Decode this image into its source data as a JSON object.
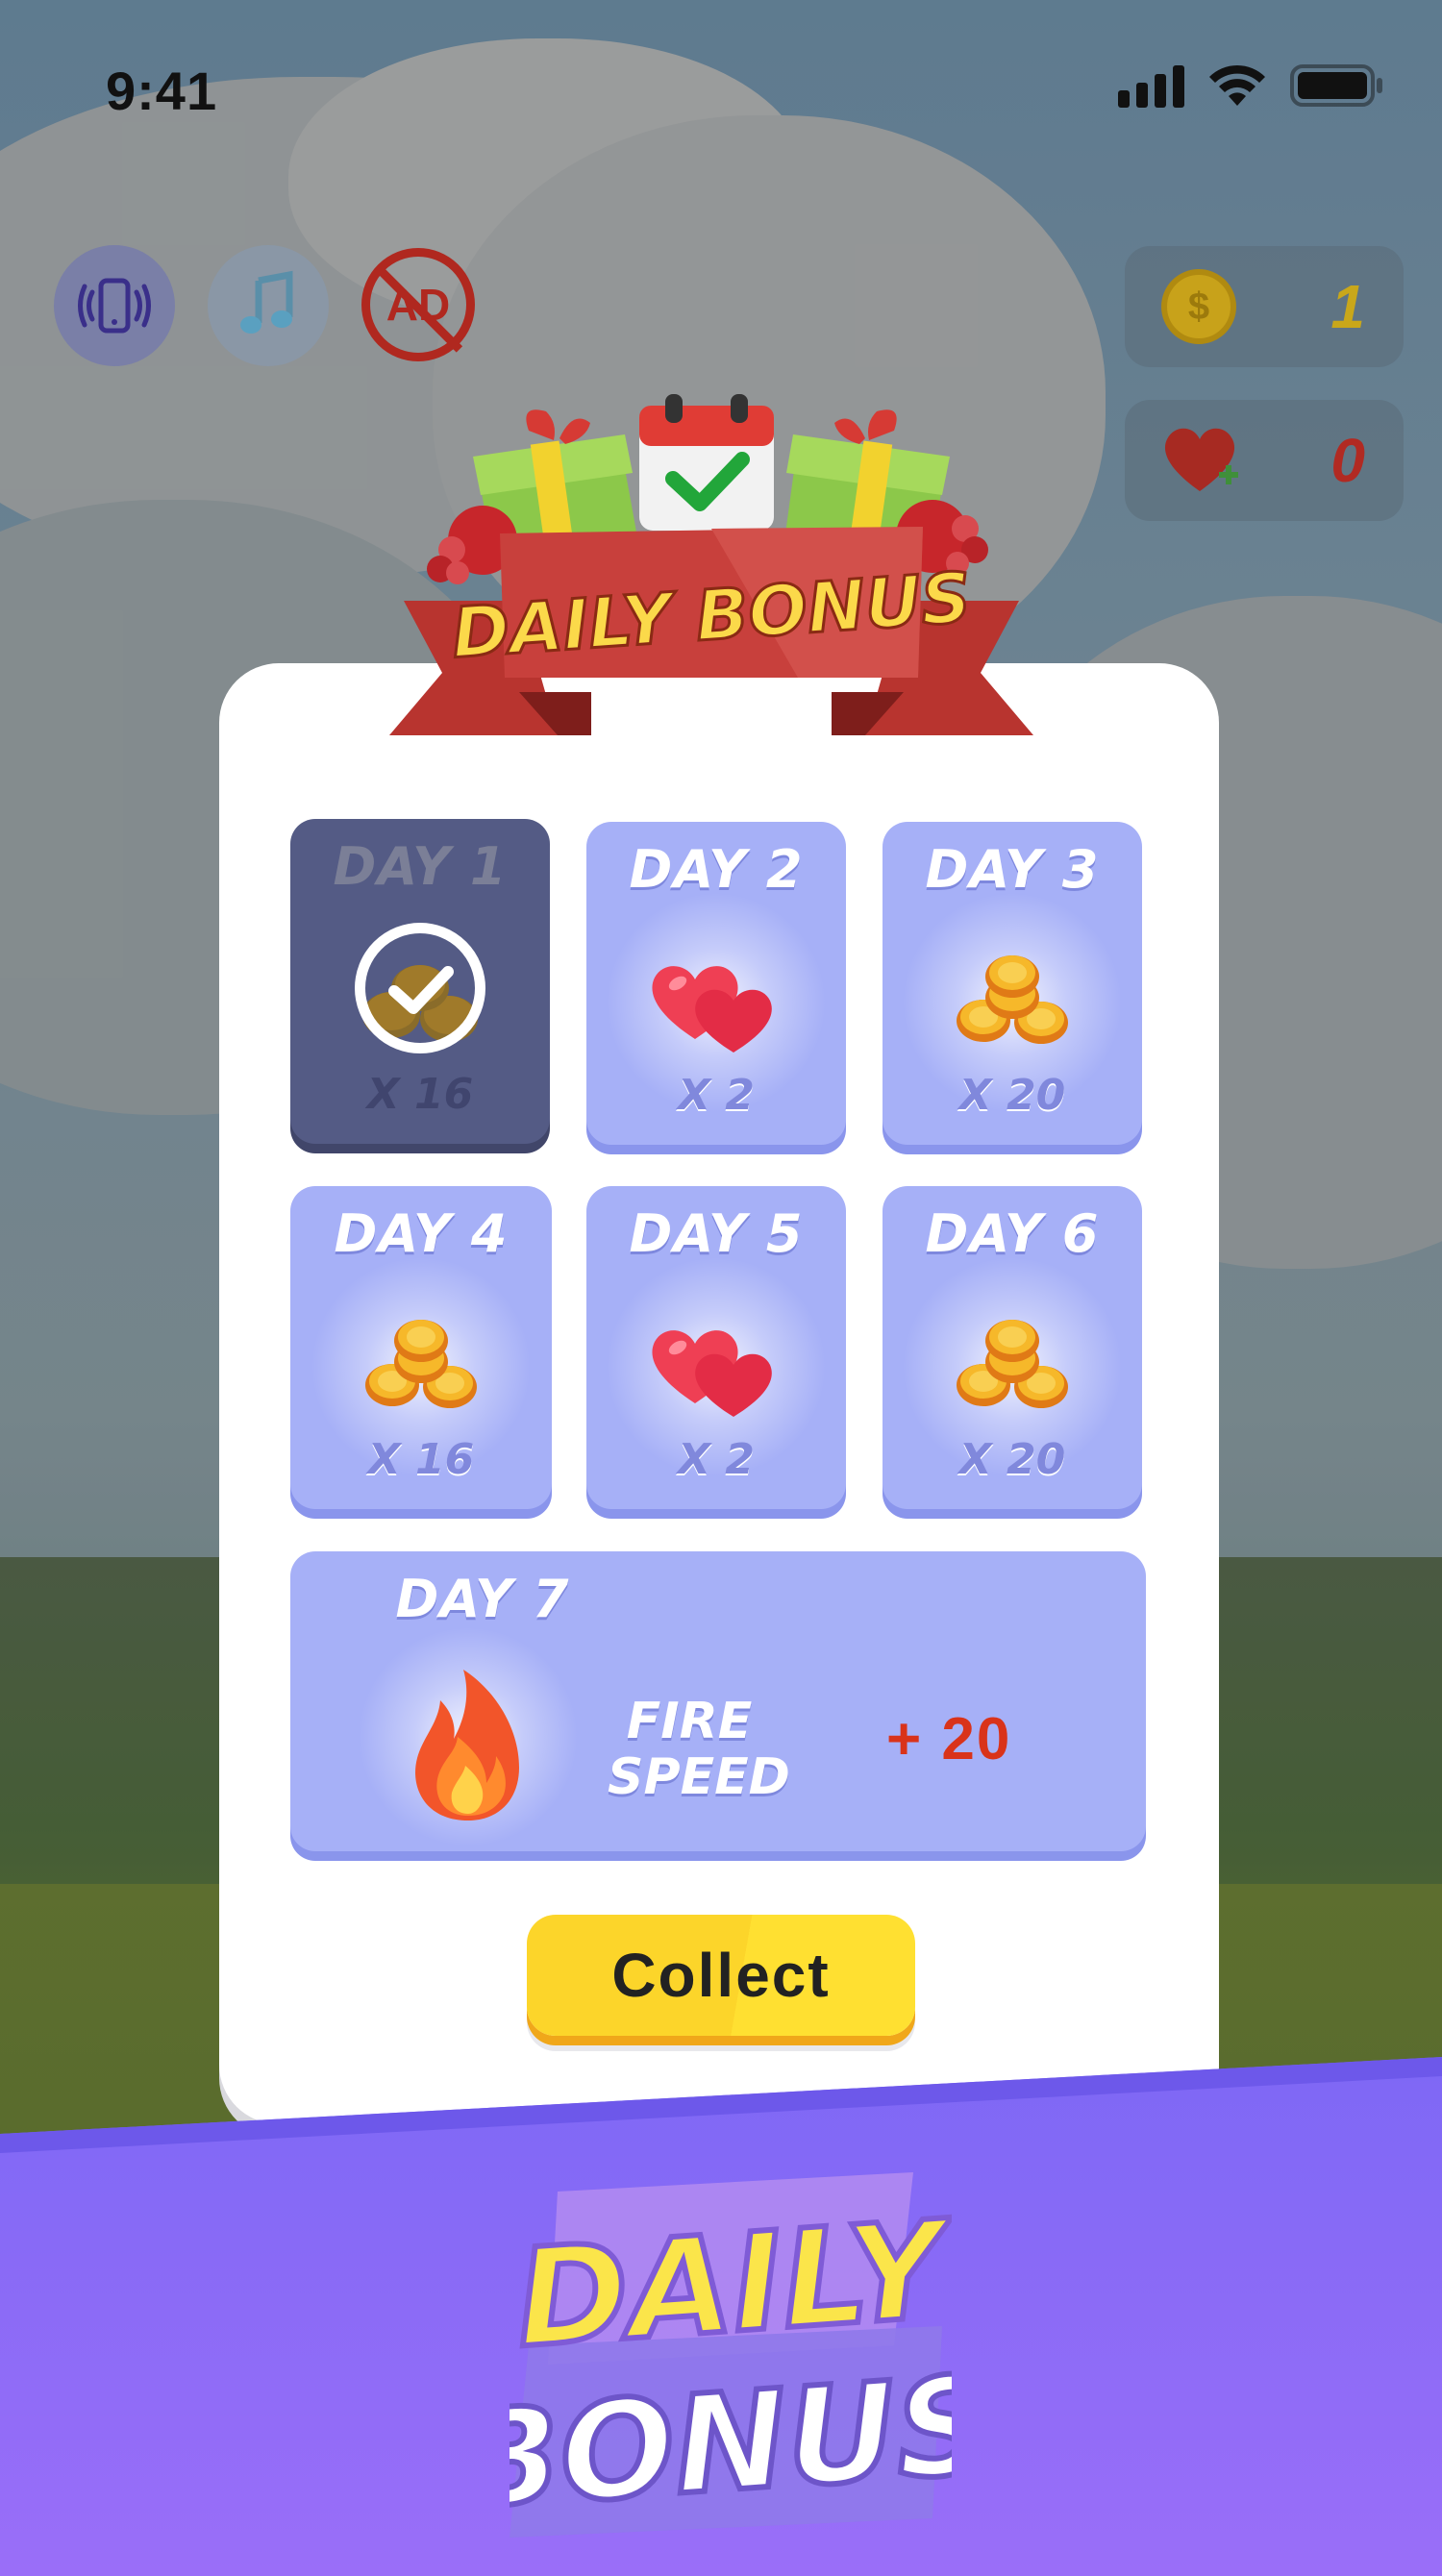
{
  "status_bar": {
    "time": "9:41"
  },
  "hud": {
    "vibration_icon": "vibration-icon",
    "music_icon": "music-note-icon",
    "no_ads_label": "AD",
    "coins": "1",
    "hearts": "0",
    "coin_color": "#c8a21a",
    "heart_color": "#b12a22"
  },
  "dialog": {
    "banner_title": "DAILY BONUS",
    "days": [
      {
        "label": "DAY 1",
        "reward": "coins",
        "qty": "X 16",
        "claimed": true
      },
      {
        "label": "DAY 2",
        "reward": "hearts",
        "qty": "X 2",
        "claimed": false
      },
      {
        "label": "DAY 3",
        "reward": "coins",
        "qty": "X 20",
        "claimed": false
      },
      {
        "label": "DAY 4",
        "reward": "coins",
        "qty": "X 16",
        "claimed": false
      },
      {
        "label": "DAY 5",
        "reward": "hearts",
        "qty": "X 2",
        "claimed": false
      },
      {
        "label": "DAY 6",
        "reward": "coins",
        "qty": "X 20",
        "claimed": false
      }
    ],
    "day7": {
      "label": "DAY 7",
      "reward_line1": "FIRE",
      "reward_line2": "SPEED",
      "amount": "+ 20"
    },
    "collect_label": "Collect"
  },
  "promo": {
    "line1": "DAILY",
    "line2": "BONUS",
    "band_color": "#8a6cf6"
  },
  "colors": {
    "tile": "#a6b0f7",
    "tile_claimed": "#545b85",
    "button": "#fcd52a",
    "ribbon": "#c8403c"
  }
}
